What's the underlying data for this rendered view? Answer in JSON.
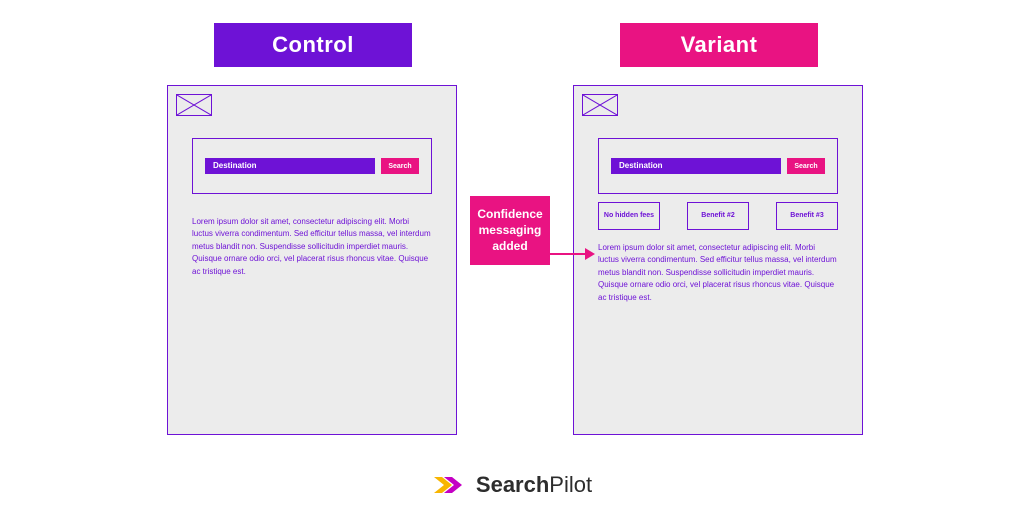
{
  "headers": {
    "control": "Control",
    "variant": "Variant"
  },
  "search": {
    "placeholder": "Destination",
    "button": "Search"
  },
  "benefits": [
    "No hidden fees",
    "Benefit #2",
    "Benefit #3"
  ],
  "body_copy": "Lorem ipsum dolor sit amet, consectetur adipiscing elit. Morbi luctus viverra condimentum. Sed efficitur tellus massa, vel interdum metus blandit non. Suspendisse sollicitudin imperdiet mauris. Quisque ornare odio orci, vel placerat risus rhoncus vitae. Quisque ac tristique est.",
  "annotation": "Confidence messaging added",
  "brand": {
    "name_bold": "Search",
    "name_light": "Pilot"
  },
  "colors": {
    "purple": "#6E12D6",
    "pink": "#E91382",
    "panel_bg": "#ECECEC"
  }
}
